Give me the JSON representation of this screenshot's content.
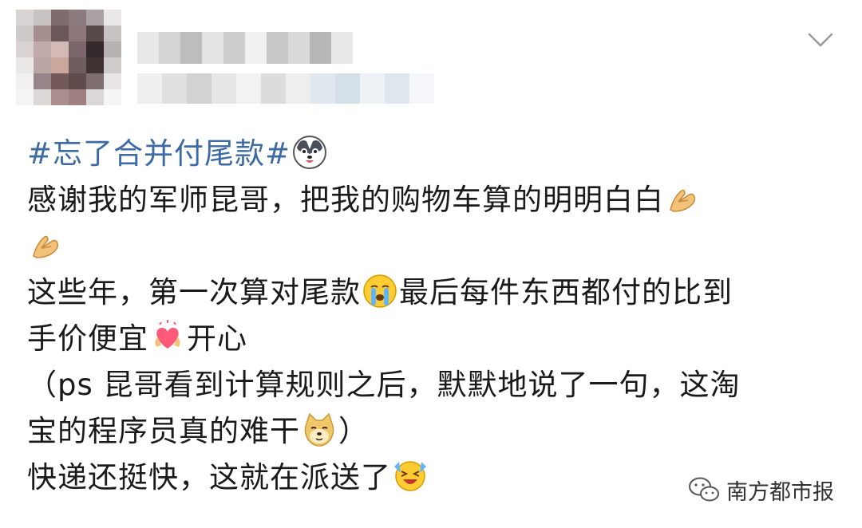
{
  "post": {
    "topic": "#忘了合并付尾款#",
    "lines": [
      "感谢我的军师昆哥，把我的购物车算的明明白白",
      "",
      "这些年，第一次算对尾款",
      "最后每件东西都付的比到",
      "手价便宜",
      "开心",
      "（ps 昆哥看到计算规则之后，默默地说了一句，这淘",
      "宝的程序员真的难干",
      "）",
      "快递还挺快，这就在派送了"
    ]
  },
  "icons": {
    "chevron": "chevron-down-icon",
    "emojis": [
      "husky-emoji",
      "pray-hands-emoji",
      "pray-hands-emoji",
      "crying-face-emoji",
      "heart-hands-emoji",
      "doge-emoji",
      "happy-tears-emoji"
    ],
    "watermark": "wechat-icon"
  },
  "watermark": {
    "text": "南方都市报"
  },
  "colors": {
    "topic": "#3d6aa3",
    "text": "#1a1a1a",
    "background": "#ffffff"
  }
}
